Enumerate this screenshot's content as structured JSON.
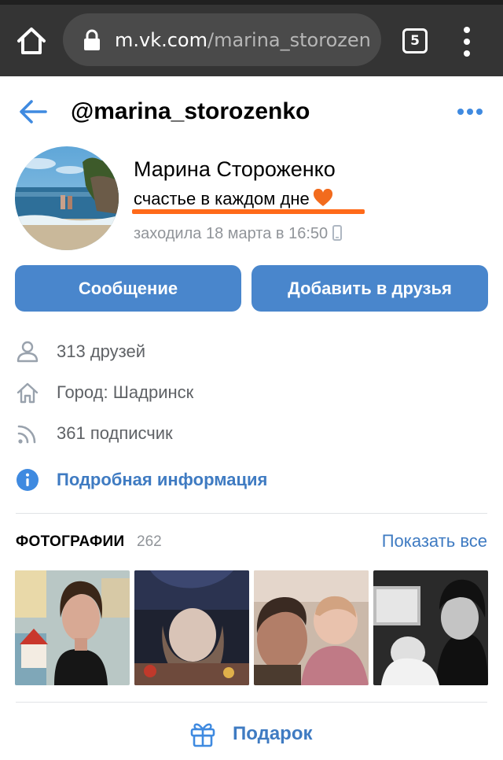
{
  "browser": {
    "url_domain": "m.vk.com",
    "url_path": "/marina_storozen",
    "tab_count": "5"
  },
  "header": {
    "handle": "@marina_storozenko"
  },
  "profile": {
    "name": "Марина Стороженко",
    "status": "счастье в каждом дне",
    "last_seen": "заходила 18 марта в 16:50",
    "status_underline_color": "#ff6a1a"
  },
  "actions": {
    "message_label": "Сообщение",
    "add_friend_label": "Добавить в друзья"
  },
  "info": {
    "friends": "313 друзей",
    "city": "Город: Шадринск",
    "followers": "361 подписчик",
    "details_link": "Подробная информация"
  },
  "photos": {
    "title": "ФОТОГРАФИИ",
    "count": "262",
    "show_all": "Показать все"
  },
  "gift": {
    "label": "Подарок"
  },
  "colors": {
    "accent": "#3f7bc2",
    "button": "#4986cc",
    "browser_bar": "#343434"
  },
  "icons": [
    "home-icon",
    "lock-icon",
    "tabs-icon",
    "menu-icon",
    "back-arrow-icon",
    "more-icon",
    "heart-icon",
    "phone-icon",
    "person-icon",
    "home-city-icon",
    "rss-icon",
    "info-icon",
    "gift-icon"
  ]
}
